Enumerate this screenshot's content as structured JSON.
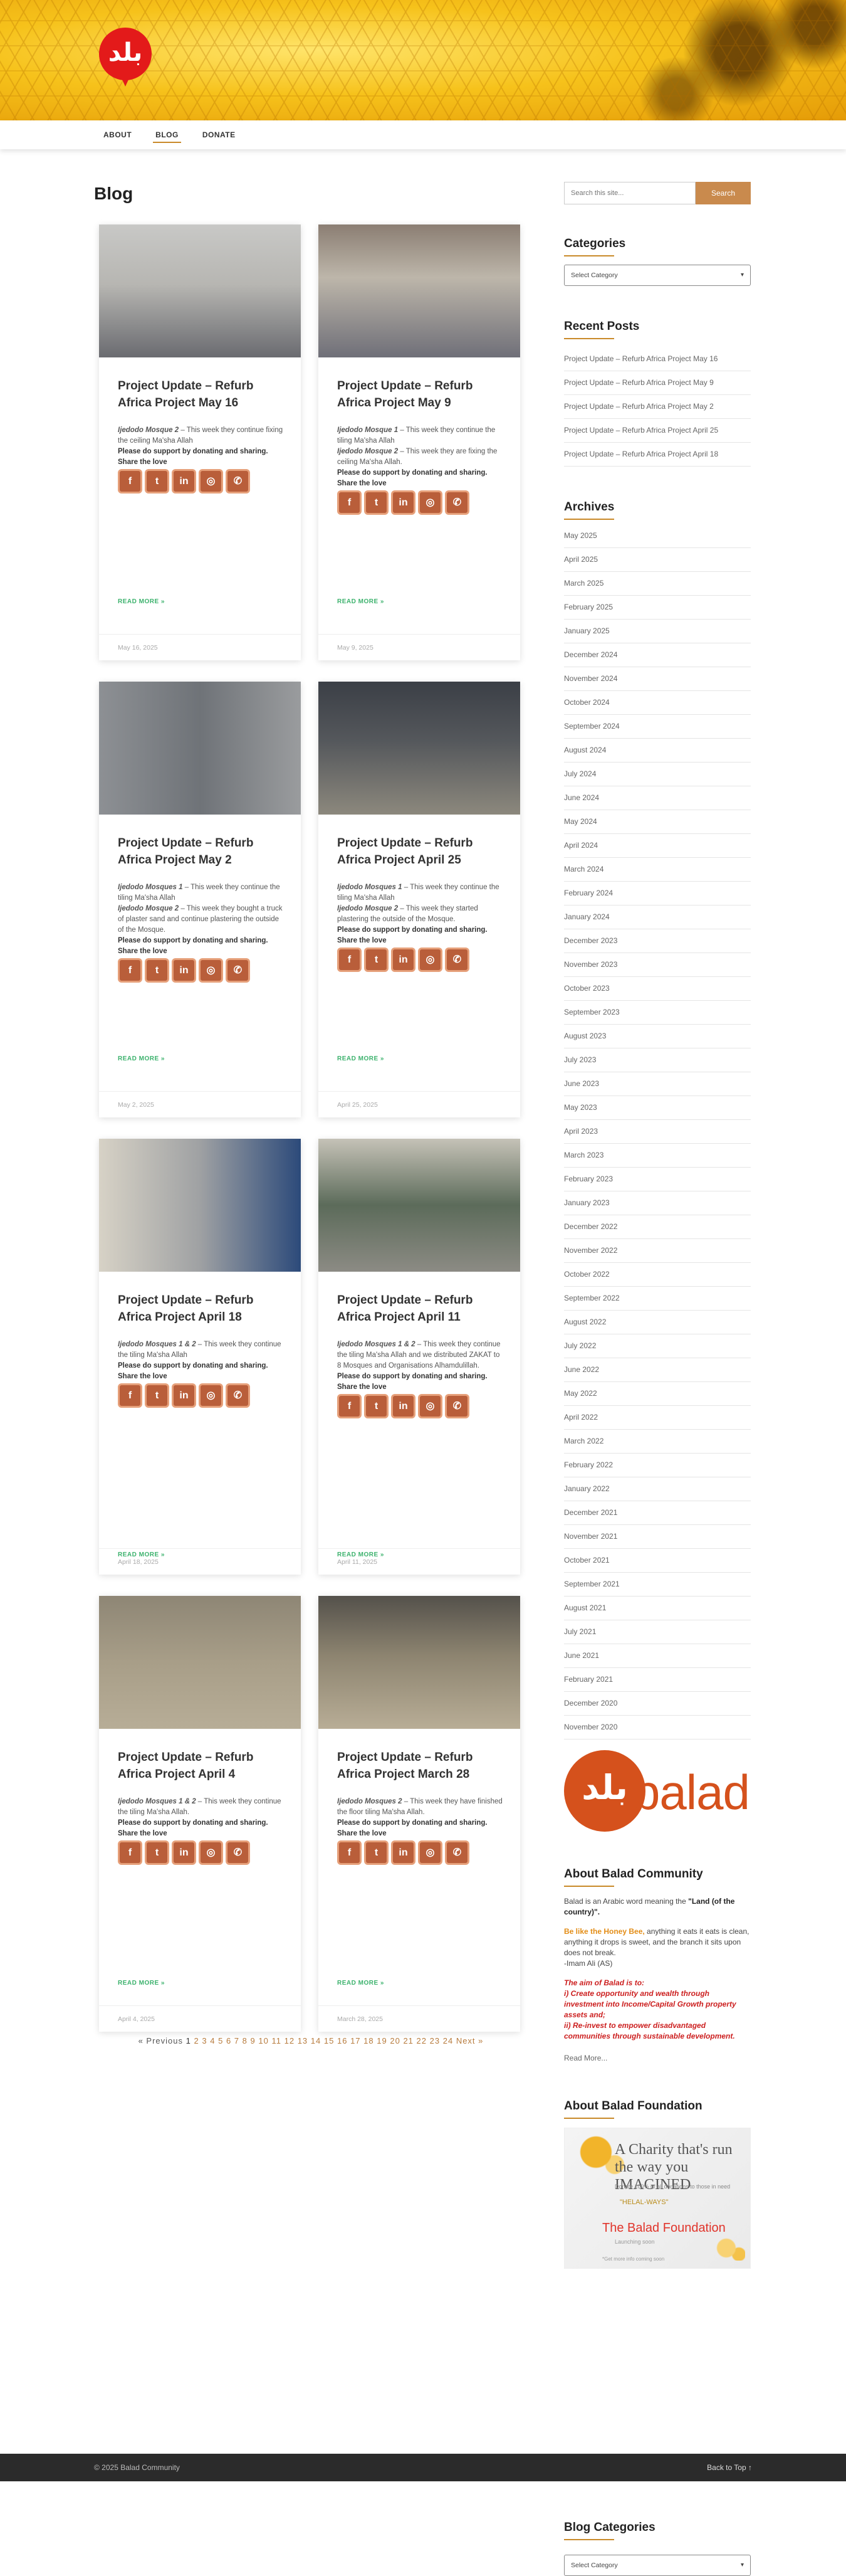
{
  "nav": {
    "items": [
      "ABOUT",
      "BLOG",
      "DONATE"
    ]
  },
  "logo": {
    "glyph": "بلد"
  },
  "page_title": "Blog",
  "posts": [
    {
      "title": "Project Update – Refurb Africa Project May 16",
      "lines": [
        {
          "em": "Ijedodo Mosque 2",
          "text": " – This week they continue fixing the ceiling Ma'sha Allah"
        },
        {
          "bold": "Please do support by donating and sharing."
        }
      ],
      "share_label": "Share the love",
      "read_more": "READ MORE »",
      "date": "May 16, 2025"
    },
    {
      "title": "Project Update – Refurb Africa Project May 9",
      "lines": [
        {
          "em": "Ijedodo Mosque 1",
          "text": " – This week they continue the tiling Ma'sha Allah"
        },
        {
          "em": "Ijedodo Mosque 2",
          "text": " – This week they are fixing the ceiling Ma'sha Allah."
        },
        {
          "bold": "Please do support by donating and sharing."
        }
      ],
      "share_label": "Share the love",
      "read_more": "READ MORE »",
      "date": "May 9, 2025"
    },
    {
      "title": "Project Update – Refurb Africa Project May 2",
      "lines": [
        {
          "em": "Ijedodo Mosques 1",
          "text": " – This week they continue the tiling Ma'sha Allah"
        },
        {
          "em": "Ijedodo Mosque 2",
          "text": " – This week they bought a truck of plaster sand and continue plastering the outside of the Mosque."
        },
        {
          "bold": "Please do support by donating and sharing."
        }
      ],
      "share_label": "Share the love",
      "read_more": "READ MORE »",
      "date": "May 2, 2025"
    },
    {
      "title": "Project Update – Refurb Africa Project April 25",
      "lines": [
        {
          "em": "Ijedodo Mosques 1",
          "text": " – This week they continue the tiling Ma'sha Allah"
        },
        {
          "em": "Ijedodo Mosque 2",
          "text": " – This week they started plastering the outside of the Mosque."
        },
        {
          "bold": "Please do support by donating and sharing."
        }
      ],
      "share_label": "Share the love",
      "read_more": "READ MORE »",
      "date": "April 25, 2025"
    },
    {
      "title": "Project Update – Refurb Africa Project April 18",
      "lines": [
        {
          "em": "Ijedodo Mosques 1 & 2",
          "text": " – This week they continue the tiling Ma'sha Allah"
        },
        {
          "bold": "Please do support by donating and sharing."
        }
      ],
      "share_label": "Share the love",
      "read_more": "READ MORE »",
      "date": "April 18, 2025"
    },
    {
      "title": "Project Update – Refurb Africa Project April 11",
      "lines": [
        {
          "em": "Ijedodo Mosques 1 & 2",
          "text": " – This week they continue the tiling Ma'sha Allah and we distributed ZAKAT to 8 Mosques and Organisations Alhamdulillah."
        },
        {
          "bold": "Please do support by donating and sharing."
        }
      ],
      "share_label": "Share the love",
      "read_more": "READ MORE »",
      "date": "April 11, 2025"
    },
    {
      "title": "Project Update – Refurb Africa Project April 4",
      "lines": [
        {
          "em": "Ijedodo Mosques 1 & 2",
          "text": " – This week they continue the tiling Ma'sha Allah."
        },
        {
          "bold": "Please do support by donating and sharing."
        }
      ],
      "share_label": "Share the love",
      "read_more": "READ MORE »",
      "date": "April 4, 2025"
    },
    {
      "title": "Project Update – Refurb Africa Project March 28",
      "lines": [
        {
          "em": "Ijedodo Mosques 2",
          "text": " – This week they have finished the floor tiling Ma'sha Allah."
        },
        {
          "bold": "Please do support by donating and sharing."
        }
      ],
      "share_label": "Share the love",
      "read_more": "READ MORE »",
      "date": "March 28, 2025"
    }
  ],
  "share_icons": [
    "facebook-icon",
    "twitter-icon",
    "linkedin-icon",
    "instagram-icon",
    "whatsapp-icon"
  ],
  "share_glyphs": [
    "f",
    "t",
    "in",
    "◎",
    "✆"
  ],
  "pagination": {
    "prev": "« Previous",
    "pages": [
      "1",
      "2",
      "3",
      "4",
      "5",
      "6",
      "7",
      "8",
      "9",
      "10",
      "11",
      "12",
      "13",
      "14",
      "15",
      "16",
      "17",
      "18",
      "19",
      "20",
      "21",
      "22",
      "23",
      "24"
    ],
    "next": "Next »"
  },
  "sidebar": {
    "search_placeholder": "Search this site...",
    "search_button": "Search",
    "categories_title": "Categories",
    "categories_select": "Select Category",
    "recent_title": "Recent Posts",
    "recent_posts": [
      "Project Update – Refurb Africa Project May 16",
      "Project Update – Refurb Africa Project May 9",
      "Project Update – Refurb Africa Project May 2",
      "Project Update – Refurb Africa Project April 25",
      "Project Update – Refurb Africa Project April 18"
    ],
    "archives_title": "Archives",
    "archives": [
      "May 2025",
      "April 2025",
      "March 2025",
      "February 2025",
      "January 2025",
      "December 2024",
      "November 2024",
      "October 2024",
      "September 2024",
      "August 2024",
      "July 2024",
      "June 2024",
      "May 2024",
      "April 2024",
      "March 2024",
      "February 2024",
      "January 2024",
      "December 2023",
      "November 2023",
      "October 2023",
      "September 2023",
      "August 2023",
      "July 2023",
      "June 2023",
      "May 2023",
      "April 2023",
      "March 2023",
      "February 2023",
      "January 2023",
      "December 2022",
      "November 2022",
      "October 2022",
      "September 2022",
      "August 2022",
      "July 2022",
      "June 2022",
      "May 2022",
      "April 2022",
      "March 2022",
      "February 2022",
      "January 2022",
      "December 2021",
      "November 2021",
      "October 2021",
      "September 2021",
      "August 2021",
      "July 2021",
      "June 2021",
      "February 2021",
      "December 2020",
      "November 2020"
    ],
    "balad_logo": {
      "glyph": "بلد",
      "word": "balad"
    },
    "about_title": "About Balad Community",
    "about_intro": "Balad is an Arabic word meaning the ",
    "about_intro_bold": "\"Land (of the country)\".",
    "honeybee_lead": "Be like the Honey Bee,",
    "honeybee_text": " anything it eats it eats is clean, anything it drops is sweet, and the branch it sits upon does not break.",
    "honeybee_attr": "-Imam Ali (AS)",
    "aim_lines": [
      "The aim of Balad is to:",
      "i) Create opportunity and wealth through investment into Income/Capital Growth property assets and;",
      "ii) Re-invest to empower disadvantaged communities through sustainable development."
    ],
    "read_more": "Read More...",
    "foundation_title": "About Balad Foundation",
    "foundation_img": {
      "line1": "A Charity that's run",
      "line2": "the way you IMAGINED",
      "small": "Donate 100% of all donations to those in need",
      "small2": "\"HELAL-WAYS\"",
      "name": "The Balad Foundation",
      "sub": "Launching soon",
      "foot": "*Get more info coming soon"
    },
    "blog_categories_title": "Blog Categories",
    "blog_categories_select": "Select Category"
  },
  "footer": {
    "copyright": "© 2025 Balad Community",
    "back_to_top": "Back to Top ↑"
  }
}
